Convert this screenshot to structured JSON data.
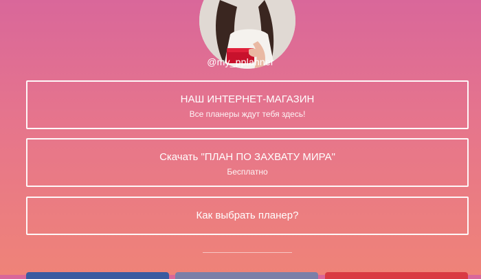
{
  "profile": {
    "username": "@my_pplanner"
  },
  "links": [
    {
      "title": "НАШ ИНТЕРНЕТ-МАГАЗИН",
      "subtitle": "Все планеры ждут тебя здесь!"
    },
    {
      "title": "Скачать \"ПЛАН ПО ЗАХВАТУ МИРА\"",
      "subtitle": "Бесплатно"
    },
    {
      "title": "Как выбрать планер?"
    }
  ],
  "colors": {
    "gradient_top": "#d9679a",
    "gradient_bottom": "#ef8378",
    "social_button_1": "#3b5ba0",
    "social_button_2": "#7b7fa8",
    "social_button_3": "#d93a43"
  }
}
